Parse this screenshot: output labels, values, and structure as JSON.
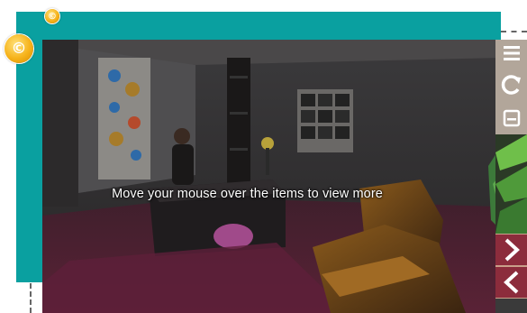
{
  "app": {
    "overlay_message": "Move your mouse over the items to view more"
  },
  "badges": {
    "small_symbol": "©",
    "large_symbol": "©"
  },
  "toolbar": {
    "buttons": [
      {
        "icon": "menu-icon"
      },
      {
        "icon": "refresh-icon"
      },
      {
        "icon": "save-icon"
      }
    ],
    "nav": [
      {
        "icon": "chevron-right-icon"
      },
      {
        "icon": "chevron-left-icon"
      }
    ]
  },
  "colors": {
    "frame": "#0aa0a0",
    "toolbar_button": "#b2a69a",
    "nav_button": "#8c2c3c",
    "coin": "#f6b21a"
  }
}
